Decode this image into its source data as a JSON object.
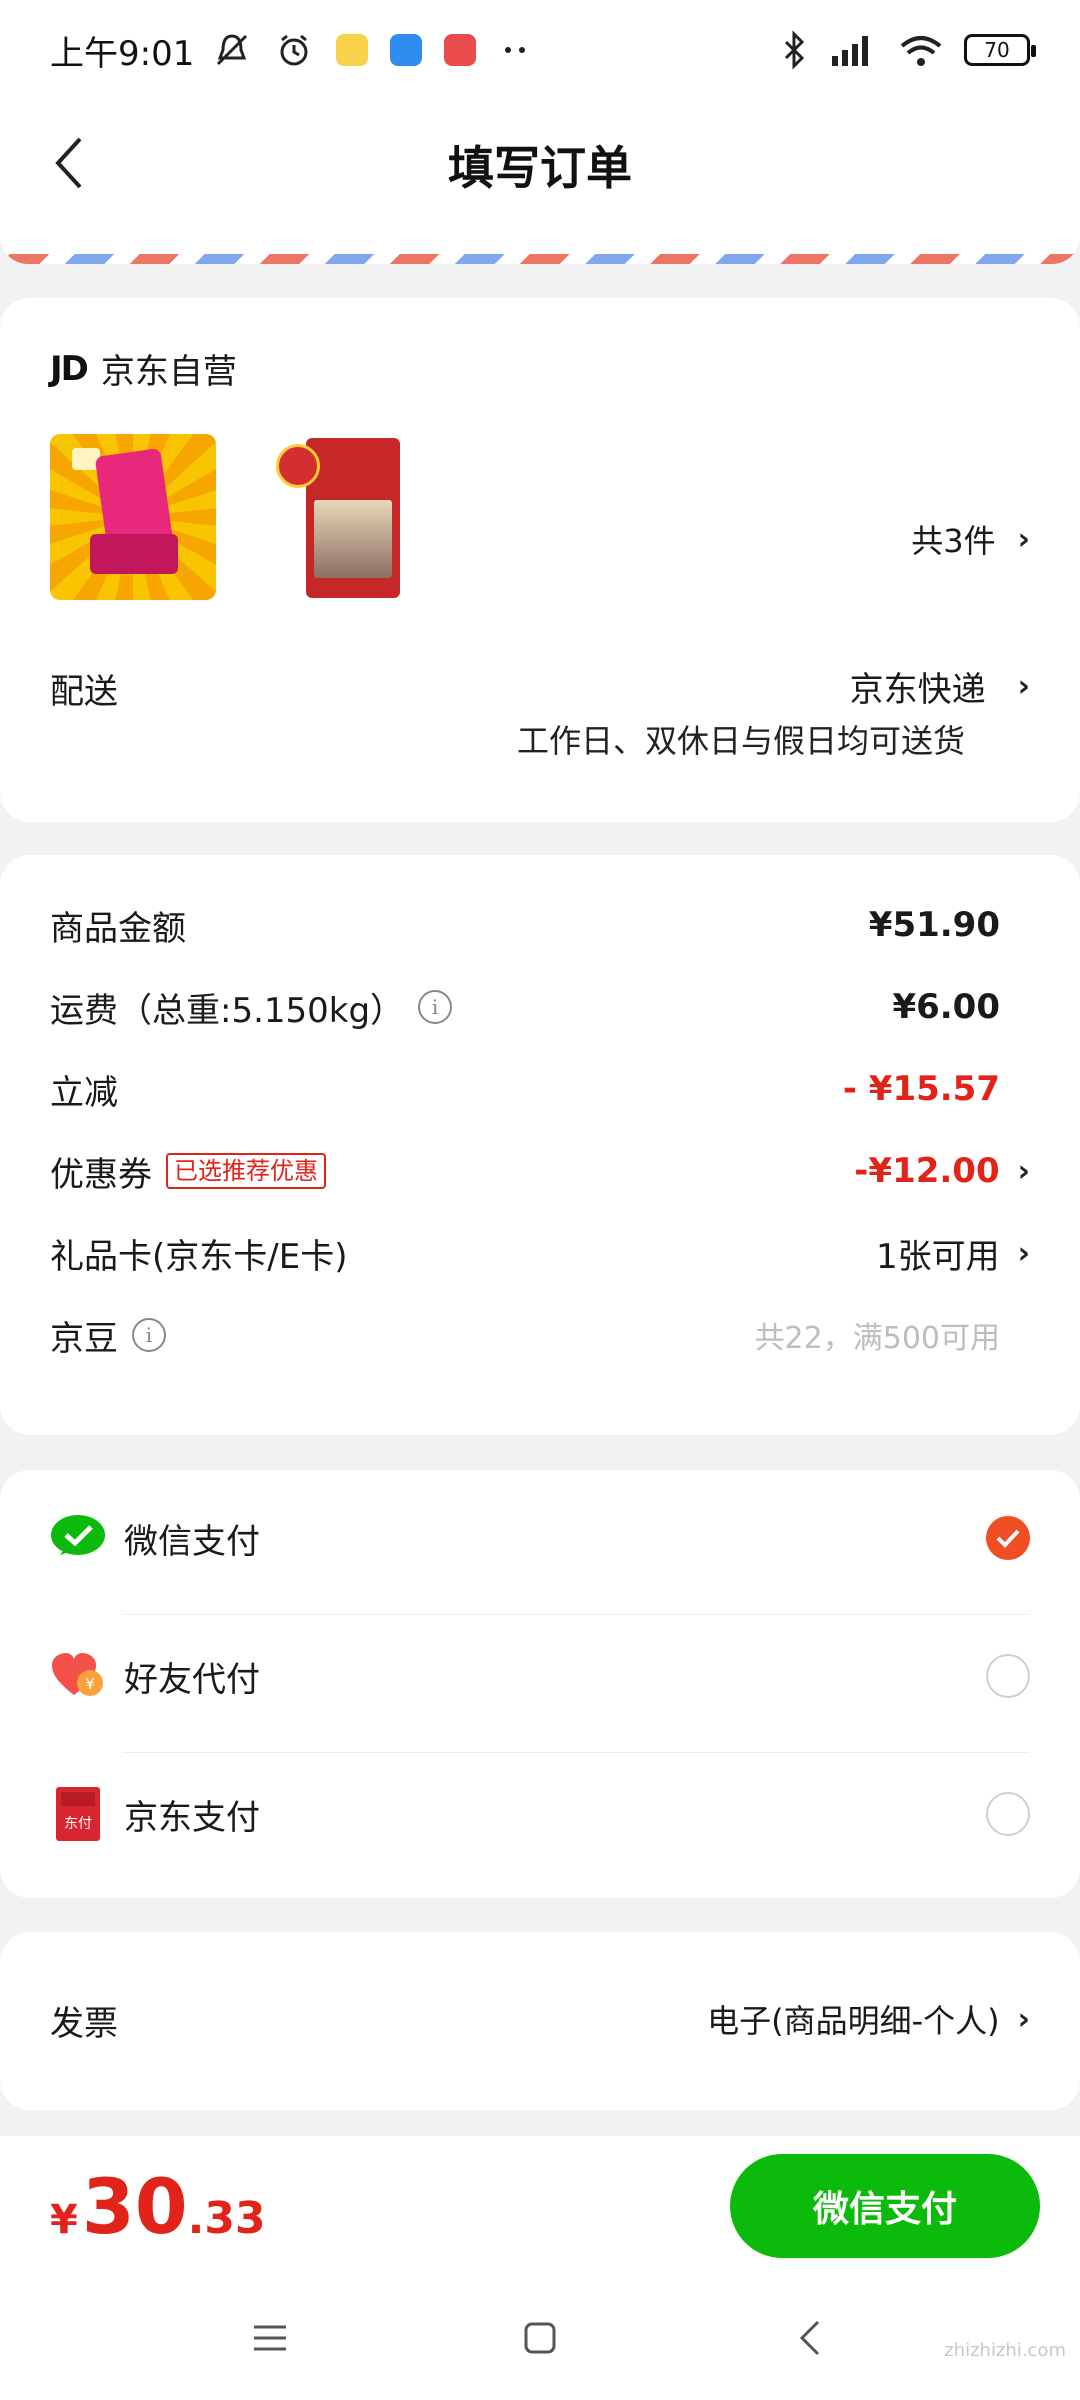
{
  "status_bar": {
    "time": "上午9:01",
    "battery": "70"
  },
  "header": {
    "title": "填写订单"
  },
  "store": {
    "logo": "JD",
    "name": "京东自营"
  },
  "products": {
    "count_label": "共3件"
  },
  "delivery": {
    "label": "配送",
    "method": "京东快递",
    "note": "工作日、双休日与假日均可送货"
  },
  "price_details": {
    "rows": [
      {
        "label": "商品金额",
        "value": "¥51.90"
      },
      {
        "label": "运费（总重:5.150kg）",
        "value": "¥6.00"
      },
      {
        "label": "立减",
        "value": "- ¥15.57"
      },
      {
        "label": "优惠券",
        "tag": "已选推荐优惠",
        "value": "-¥12.00"
      },
      {
        "label": "礼品卡(京东卡/E卡)",
        "value": "1张可用"
      },
      {
        "label": "京豆",
        "value": "共22，满500可用"
      }
    ]
  },
  "payment": {
    "options": [
      {
        "label": "微信支付",
        "selected": true
      },
      {
        "label": "好友代付",
        "selected": false
      },
      {
        "label": "京东支付",
        "selected": false,
        "icon_text": "东付"
      }
    ]
  },
  "invoice": {
    "label": "发票",
    "value": "电子(商品明细-个人)"
  },
  "bottom": {
    "currency": "¥",
    "total_int": "30",
    "total_dec": ".33",
    "pay_button": "微信支付"
  },
  "watermark": "zhizhizhi.com",
  "colors": {
    "accent_red": "#e2231a",
    "wechat_green": "#0bba0b",
    "radio_orange": "#f04e23"
  }
}
